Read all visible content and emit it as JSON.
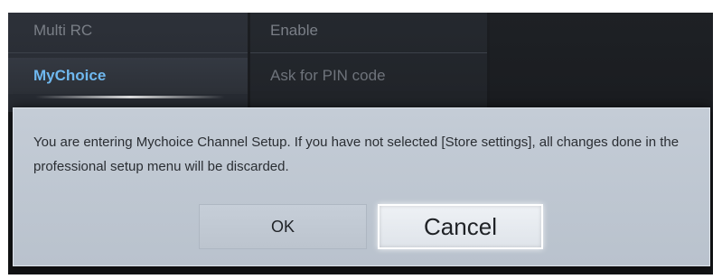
{
  "menu": {
    "left_column": {
      "items": [
        {
          "label": "Multi RC"
        },
        {
          "label": "MyChoice"
        }
      ]
    },
    "middle_column": {
      "items": [
        {
          "label": "Enable"
        },
        {
          "label": "Ask for PIN code"
        }
      ]
    },
    "selected_color": "#6fb8ef"
  },
  "dialog": {
    "message": "You are entering Mychoice Channel Setup. If you have not selected [Store settings], all changes done in the professional setup menu will be discarded.",
    "ok_label": "OK",
    "cancel_label": "Cancel",
    "focused_button": "Cancel"
  }
}
